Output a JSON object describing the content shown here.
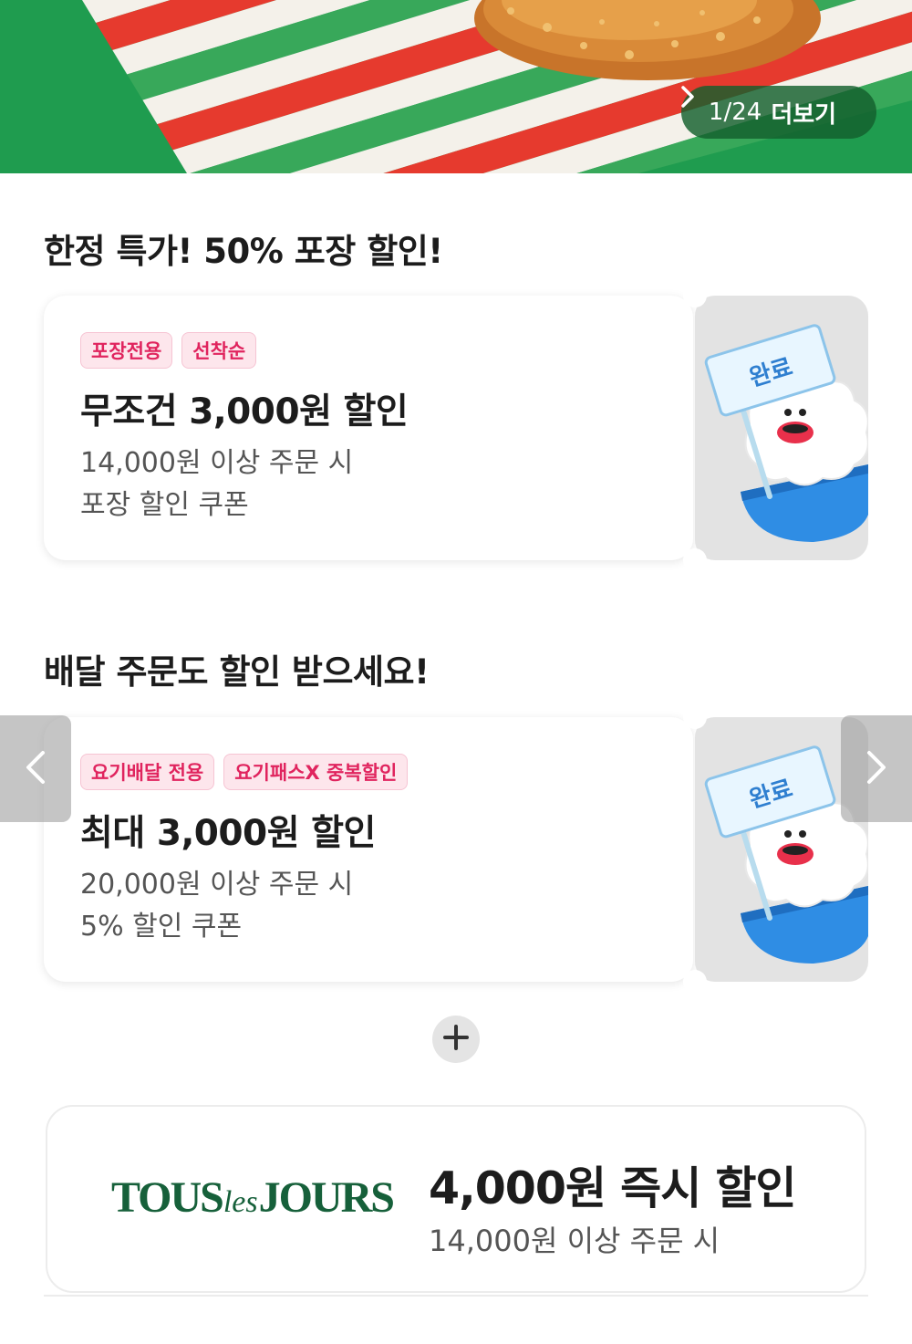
{
  "banner": {
    "pager_count": "1/24",
    "more_label": "더보기",
    "more_icon": "chevron-right-icon",
    "colors": {
      "green": "#1a9a4a",
      "red": "#e63a2e",
      "stripe_white": "#f4f1ea"
    }
  },
  "sections": [
    {
      "title": "한정 특가! 50% 포장 할인!",
      "coupon": {
        "tags": [
          "포장전용",
          "선착순"
        ],
        "title": "무조건 3,000원 할인",
        "condition": "14,000원 이상 주문 시",
        "type": "포장 할인 쿠폰",
        "status": "완료"
      }
    },
    {
      "title": "배달 주문도 할인 받으세요!",
      "coupon": {
        "tags": [
          "요기배달 전용",
          "요기패스X 중복할인"
        ],
        "title": "최대 3,000원 할인",
        "condition": "20,000원 이상 주문 시",
        "type": "5% 할인 쿠폰",
        "status": "완료"
      }
    }
  ],
  "carousel": {
    "prev_icon": "chevron-left-icon",
    "next_icon": "chevron-right-icon"
  },
  "expand": {
    "icon": "plus-icon"
  },
  "brand_offer": {
    "logo_left": "TOUS",
    "logo_mid": "les",
    "logo_right": "JOURS",
    "title": "4,000원 즉시 할인",
    "condition": "14,000원 이상 주문 시",
    "logo_color": "#16603a"
  },
  "accent_colors": {
    "tag_text": "#e0245e",
    "tag_bg": "#fde6ec"
  }
}
